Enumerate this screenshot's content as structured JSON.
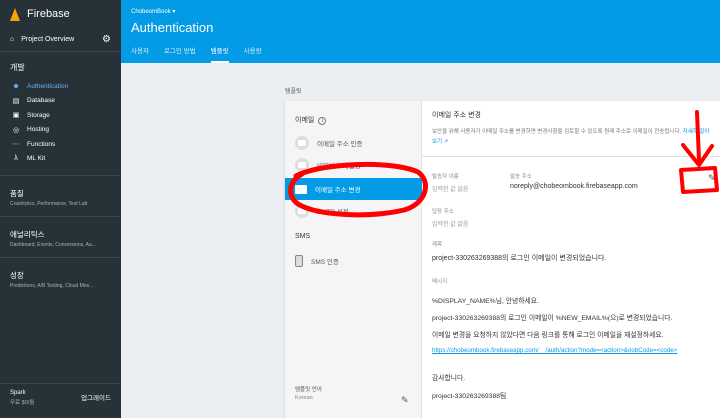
{
  "sidebar": {
    "brand": "Firebase",
    "overview": "Project Overview",
    "develop_title": "개발",
    "items": [
      {
        "label": "Authentication",
        "icon": "people-icon"
      },
      {
        "label": "Database",
        "icon": "database-icon"
      },
      {
        "label": "Storage",
        "icon": "storage-icon"
      },
      {
        "label": "Hosting",
        "icon": "hosting-icon"
      },
      {
        "label": "Functions",
        "icon": "functions-icon"
      },
      {
        "label": "ML Kit",
        "icon": "mlkit-icon"
      }
    ],
    "groups": [
      {
        "title": "품질",
        "sub": "Crashlytics, Performance, Test Lab"
      },
      {
        "title": "애널리틱스",
        "sub": "Dashboard, Events, Conversions, Au..."
      },
      {
        "title": "성장",
        "sub": "Predictions, A/B Testing, Cloud Mes..."
      }
    ],
    "plan": "Spark",
    "plan_usage": "무료 $0/월",
    "upgrade": "업그레이드"
  },
  "header": {
    "project": "ChobeomBook",
    "title": "Authentication",
    "tabs": [
      "사용자",
      "로그인 방법",
      "템플릿",
      "사용량"
    ],
    "active_tab": 2
  },
  "content": {
    "section_label": "템플릿",
    "left": {
      "email_heading": "이메일",
      "items": [
        "이메일 주소 인증",
        "비밀번호 재설정",
        "이메일 주소 변경",
        "SMTP 설정"
      ],
      "sms_heading": "SMS",
      "sms_item": "SMS 인증",
      "lang_label": "템플릿 언어",
      "lang_value": "Korean"
    },
    "right": {
      "title": "이메일 주소 변경",
      "desc": "보안을 위해 사용자가 이메일 주소를 변경하면 변경사항을 검토할 수 있도록 원래 주소로 이메일이 전송됩니다.",
      "desc_link": "자세히 알아보기",
      "sender_name_label": "발송자 이름",
      "sender_name_value": "입력한 값 없음",
      "sender_addr_label": "발송 주소",
      "sender_addr_value": "noreply@chobeombook.firebaseapp.com",
      "reply_label": "답장 주소",
      "reply_value": "입력한 값 없음",
      "subject_label": "제목",
      "subject_value": "project-330263269388의 로그인 이메일이 변경되었습니다.",
      "message_label": "메시지",
      "message_lines": [
        "%DISPLAY_NAME%님, 안녕하세요.",
        "project-330263269388의 로그인 이메일이 %NEW_EMAIL%(으)로 변경되었습니다.",
        "이메일 변경을 요청하지 않았다면 다음 링크를 통해 로그인 이메일을 재설정하세요.",
        "감사합니다.",
        "project-330263269388팀"
      ],
      "message_link": "https://chobeombook.firebaseapp.com/__/auth/action?mode=<action>&oobCode=<code>"
    }
  },
  "colors": {
    "sidebar_bg": "#263238",
    "header_bg": "#039be5",
    "accent": "#039be5",
    "annotation_red": "#ff0000"
  }
}
